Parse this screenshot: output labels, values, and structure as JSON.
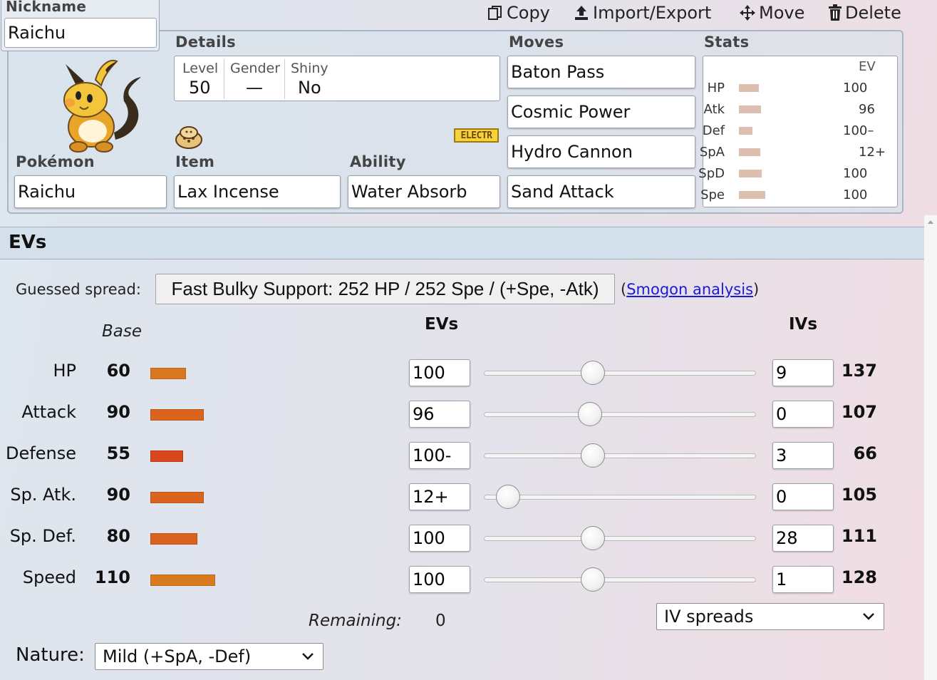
{
  "toolbar": {
    "copy": "Copy",
    "import_export": "Import/Export",
    "move": "Move",
    "delete": "Delete"
  },
  "nickname": {
    "label": "Nickname",
    "value": "Raichu"
  },
  "details": {
    "heading": "Details",
    "level_label": "Level",
    "level": "50",
    "gender_label": "Gender",
    "gender": "—",
    "shiny_label": "Shiny",
    "shiny": "No",
    "type_badge": "ELECTR"
  },
  "pokemon": {
    "label": "Pokémon",
    "value": "Raichu"
  },
  "item": {
    "label": "Item",
    "value": "Lax Incense"
  },
  "ability": {
    "label": "Ability",
    "value": "Water Absorb"
  },
  "moves": {
    "heading": "Moves",
    "list": [
      "Baton Pass",
      "Cosmic Power",
      "Hydro Cannon",
      "Sand Attack"
    ]
  },
  "stats_panel": {
    "heading": "Stats",
    "ev_label": "EV",
    "rows": [
      {
        "label": "HP",
        "ev": "100"
      },
      {
        "label": "Atk",
        "ev": "96"
      },
      {
        "label": "Def",
        "ev": "100–"
      },
      {
        "label": "SpA",
        "ev": "12+"
      },
      {
        "label": "SpD",
        "ev": "100"
      },
      {
        "label": "Spe",
        "ev": "100"
      }
    ]
  },
  "evs_section": {
    "title": "EVs",
    "guessed_label": "Guessed spread:",
    "guessed_value": "Fast Bulky Support: 252 HP / 252 Spe / (+Spe, -Atk)",
    "paren_open": "(",
    "smogon_link": "Smogon analysis",
    "paren_close": ")",
    "col_base": "Base",
    "col_evs": "EVs",
    "col_ivs": "IVs",
    "rows": [
      {
        "name": "HP",
        "base": "60",
        "ev": "100",
        "iv": "9",
        "total": "137",
        "slider": 0.4,
        "bar_color": "#d9781e"
      },
      {
        "name": "Attack",
        "base": "90",
        "ev": "96",
        "iv": "0",
        "total": "107",
        "slider": 0.39,
        "bar_color": "#d9641e"
      },
      {
        "name": "Defense",
        "base": "55",
        "ev": "100-",
        "iv": "3",
        "total": "66",
        "slider": 0.4,
        "bar_color": "#d9461e"
      },
      {
        "name": "Sp. Atk.",
        "base": "90",
        "ev": "12+",
        "iv": "0",
        "total": "105",
        "slider": 0.09,
        "bar_color": "#d9641e"
      },
      {
        "name": "Sp. Def.",
        "base": "80",
        "ev": "100",
        "iv": "28",
        "total": "111",
        "slider": 0.4,
        "bar_color": "#d9621e"
      },
      {
        "name": "Speed",
        "base": "110",
        "ev": "100",
        "iv": "1",
        "total": "128",
        "slider": 0.4,
        "bar_color": "#d97a1e"
      }
    ],
    "remaining_label": "Remaining:",
    "remaining_value": "0",
    "iv_spreads": "IV spreads",
    "nature_label": "Nature:",
    "nature_value": "Mild (+SpA, -Def)"
  }
}
